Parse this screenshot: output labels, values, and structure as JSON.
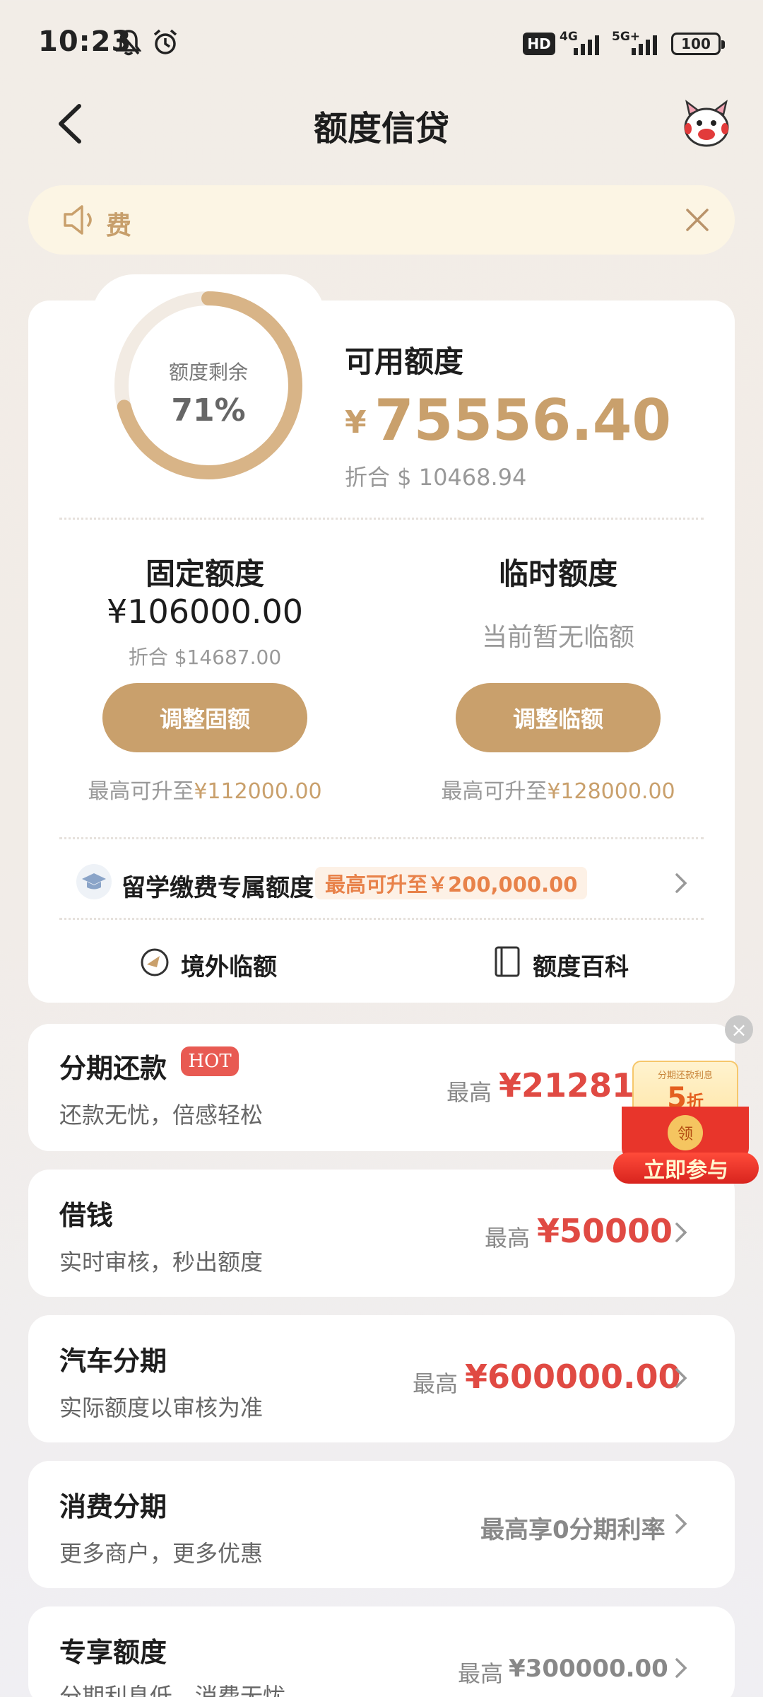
{
  "status_bar": {
    "time": "10:23",
    "hd_label": "HD",
    "net1": "4G",
    "net2": "5G+",
    "battery": "100"
  },
  "header": {
    "title": "额度信贷"
  },
  "notice": {
    "text": "费"
  },
  "credit": {
    "ring_label": "额度剩余",
    "ring_percent": "71%",
    "ring_value": 0.71,
    "available_title": "可用额度",
    "currency": "¥",
    "available_amount": "75556.40",
    "converted": "折合 $ 10468.94"
  },
  "fixed": {
    "title": "固定额度",
    "amount": "¥106000.00",
    "converted": "折合 $14687.00",
    "button": "调整固额",
    "max_prefix": "最高可升至",
    "max_value": "¥112000.00"
  },
  "temporary": {
    "title": "临时额度",
    "status": "当前暂无临额",
    "button": "调整临额",
    "max_prefix": "最高可升至",
    "max_value": "¥128000.00"
  },
  "study": {
    "label": "留学缴费专属额度",
    "tag": "最高可升至￥200,000.00"
  },
  "links": {
    "overseas": "境外临额",
    "wiki": "额度百科"
  },
  "products": [
    {
      "title": "分期还款",
      "badge": "HOT",
      "subtitle": "还款无忧，倍感轻松",
      "prefix": "最高",
      "amount": "¥21281.0"
    },
    {
      "title": "借钱",
      "subtitle": "实时审核，秒出额度",
      "prefix": "最高",
      "amount": "¥50000"
    },
    {
      "title": "汽车分期",
      "subtitle": "实际额度以审核为准",
      "prefix": "最高",
      "amount": "¥600000.00"
    },
    {
      "title": "消费分期",
      "subtitle": "更多商户，更多优惠",
      "right_text": "最高享0分期利率"
    },
    {
      "title": "专享额度",
      "subtitle": "分期利息低，消费无忧",
      "prefix": "最高",
      "amount": "¥300000.00"
    }
  ],
  "promo": {
    "top_text": "分期还款利息",
    "discount": "5",
    "discount_unit": "折",
    "seal": "领",
    "cta": "立即参与"
  },
  "colors": {
    "gold": "#c9a06c",
    "red": "#e04a43",
    "notice_bg": "#fcf5e4"
  }
}
